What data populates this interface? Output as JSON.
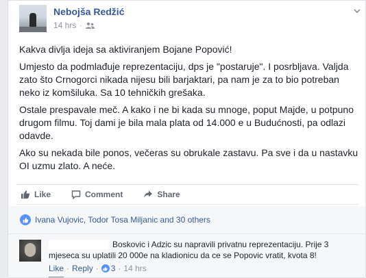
{
  "post": {
    "author": "Nebojša Redžić",
    "time": "14 hrs",
    "dot": "·",
    "paragraphs": [
      "Kakva divlja ideja sa aktiviranjem Bojane Popović!",
      "Umjesto da podmlađuje reprezentaciju, dps je \"postaruje\". I posrbljava. Valjda zato što Crnogorci nikada nijesu bili barjaktari, pa nam je za to bio potreban neko iz komšiluka. Sa 10 tehničkih grešaka.",
      "Ostale prespavale meč. A kako i ne bi kada su mnoge, poput Majde, u potpuno drugom filmu. Toj dami je bila mala plata od 14.000 e u Budućnosti, pa odlazi odavde.",
      "Ako su nekada bile ponos, večeras su obrukale zastavu. Pa sve i da u nastavku OI uzmu zlato. A neće."
    ]
  },
  "actions": {
    "like": "Like",
    "comment": "Comment",
    "share": "Share"
  },
  "reactions": {
    "summary": "Ivana Vujovic, Todor Tosa Miljanic and 30 others"
  },
  "comment": {
    "text": "Boskovic i Adzic su napravili privatnu reprezentaciju. Prije 3 mjeseca su uplatili 20 000e na kladionicu da ce se Popovic vratit, kvota 8!",
    "like": "Like",
    "reply": "Reply",
    "sep": "·",
    "like_count": "3",
    "time": "14 hrs"
  },
  "colors": {
    "link": "#365899",
    "meta": "#90949c",
    "like_badge": "#5890ff"
  }
}
